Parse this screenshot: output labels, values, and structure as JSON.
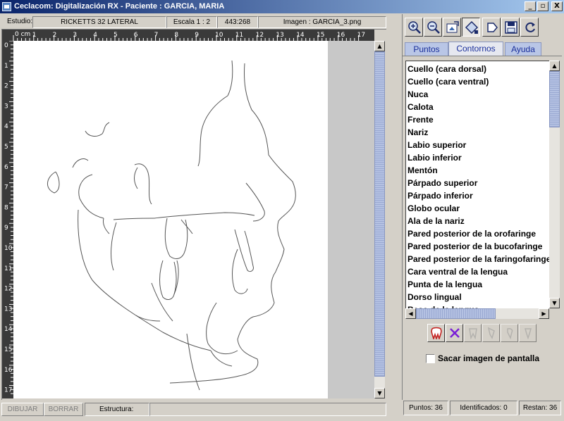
{
  "window": {
    "title": "Ceclacom: Digitalización RX - Paciente : GARCIA, MARIA",
    "minimize": "_",
    "maximize": "▫",
    "close": "X"
  },
  "info": {
    "estudio_label": "Estudio:",
    "estudio_value": "RICKETTS 32 LATERAL",
    "escala": "Escala   1 : 2",
    "coords": "443:268",
    "imagen": "Imagen : GARCIA_3.png"
  },
  "ruler": {
    "unit_label": "0 cm",
    "top_ticks": [
      "1",
      "2",
      "3",
      "4",
      "5",
      "6",
      "7",
      "8",
      "9",
      "10",
      "11",
      "12",
      "13",
      "14",
      "15",
      "16",
      "17"
    ],
    "left_ticks": [
      "0",
      "1",
      "2",
      "3",
      "4",
      "5",
      "6",
      "7",
      "8",
      "9",
      "10",
      "11",
      "12",
      "13",
      "14",
      "15",
      "16",
      "17"
    ]
  },
  "status_left": {
    "dibujar": "DIBUJAR",
    "borrar": "BORRAR",
    "estructura_label": "Estructura:"
  },
  "toolbar": {
    "icons": [
      "zoom-in-icon",
      "zoom-out-icon",
      "pan-image-icon",
      "select-region-icon",
      "next-icon",
      "save-icon",
      "refresh-icon"
    ]
  },
  "tabs": [
    "Puntos",
    "Contornos",
    "Ayuda"
  ],
  "active_tab": "Contornos",
  "contours": [
    "Cuello (cara dorsal)",
    "Cuello (cara ventral)",
    "Nuca",
    "Calota",
    "Frente",
    "Nariz",
    "Labio superior",
    "Labio inferior",
    "Mentón",
    "Párpado superior",
    "Párpado inferior",
    "Globo ocular",
    "Ala de la nariz",
    "Pared posterior de la orofaringe",
    "Pared posterior de la bucofaringe",
    "Pared posterior de la faringofaringe",
    "Cara ventral de la lengua",
    "Punta de la lengua",
    "Dorso lingual",
    "Base de la lengua"
  ],
  "actions": {
    "icons": [
      "tooth-icon",
      "delete-x-icon",
      "tooth-gray-icon",
      "tooth-gray-icon-2",
      "tooth-gray-icon-3",
      "tooth-gray-icon-4"
    ],
    "delete_color": "#7a1fd6"
  },
  "screenshot_option": "Sacar imagen de pantalla",
  "status_right": {
    "puntos": "Puntos: 36",
    "identificados": "Identificados: 0",
    "restan": "Restan: 36"
  }
}
